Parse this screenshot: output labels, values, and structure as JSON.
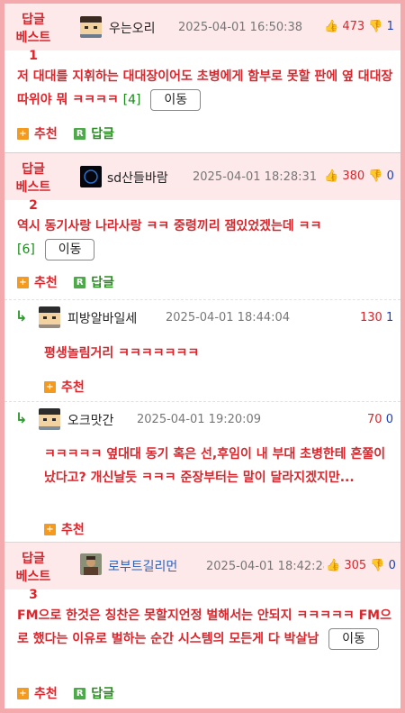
{
  "comments": [
    {
      "label_line1": "답글",
      "label_line2": "베스트1",
      "author": "우는오리",
      "date": "2025-04-01 16:50:38",
      "up": "473",
      "down": "1",
      "text": "저 대대를 지휘하는 대대장이어도 초병에게 함부로 못할 판에 옆 대대장따위야 뭐 ㅋㅋㅋㅋ",
      "reply_count": "[4]",
      "move_label": "이동",
      "recommend_label": "추천",
      "reply_label": "답글"
    },
    {
      "label_line1": "답글",
      "label_line2": "베스트2",
      "author": "sd산들바람",
      "date": "2025-04-01 18:28:31",
      "up": "380",
      "down": "0",
      "text": "역시 동기사랑 나라사랑 ㅋㅋ 중령끼리 잼있었겠는데 ㅋㅋ",
      "reply_count": "[6]",
      "move_label": "이동",
      "recommend_label": "추천",
      "reply_label": "답글"
    },
    {
      "label_line1": "답글",
      "label_line2": "베스트3",
      "author": "로부트길리먼",
      "date": "2025-04-01 18:42:28",
      "up": "305",
      "down": "0",
      "text": "FM으로 한것은 칭찬은 못할지언정 벌해서는 안되지 ㅋㅋㅋㅋㅋ FM으로 했다는 이유로 벌하는 순간 시스템의 모든게 다 박살남",
      "move_label": "이동",
      "recommend_label": "추천",
      "reply_label": "답글"
    }
  ],
  "replies": [
    {
      "author": "피방알바일세",
      "date": "2025-04-01 18:44:04",
      "up": "130",
      "down": "1",
      "text": "평생놀림거리 ㅋㅋㅋㅋㅋㅋㅋ",
      "recommend_label": "추천"
    },
    {
      "author": "오크맛간",
      "date": "2025-04-01 19:20:09",
      "up": "70",
      "down": "0",
      "text": "ㅋㅋㅋㅋㅋ 옆대대 동기 혹은 선,후임이 내 부대 초병한테 혼쭐이 났다고? 개신날듯 ㅋㅋㅋ 준장부터는 말이 달라지겠지만...",
      "recommend_label": "추천"
    }
  ]
}
